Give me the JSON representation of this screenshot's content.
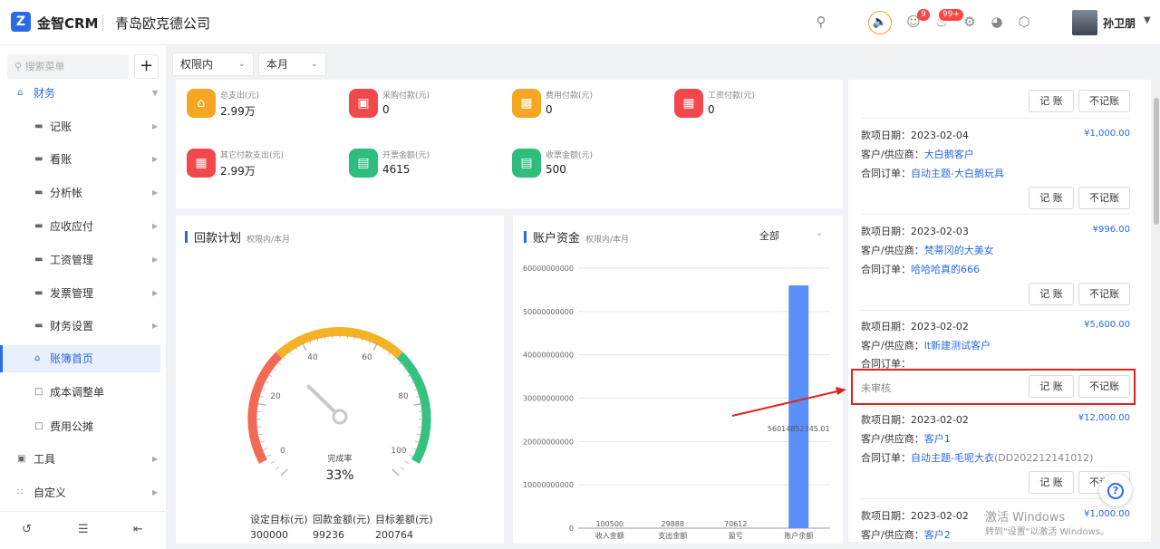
{
  "header": {
    "logo_mark": "Z",
    "logo": "金智CRM",
    "company": "青岛欧克德公司",
    "badge_tasks": "9",
    "badge_notices": "99+",
    "user": "孙卫朋"
  },
  "sidebar": {
    "search_placeholder": "搜索菜单",
    "plus": "+",
    "group": "财务",
    "items": [
      {
        "label": "记账"
      },
      {
        "label": "看账"
      },
      {
        "label": "分析帐"
      },
      {
        "label": "应收应付"
      },
      {
        "label": "工资管理"
      },
      {
        "label": "发票管理"
      },
      {
        "label": "财务设置"
      },
      {
        "label": "账簿首页"
      },
      {
        "label": "成本调整单"
      },
      {
        "label": "费用公摊"
      }
    ],
    "tools": "工具",
    "custom": "自定义"
  },
  "filters": {
    "scope": "权限内",
    "period": "本月"
  },
  "stats": [
    {
      "label": "总支出(元)",
      "value": "2.99万",
      "color": "#f5a623"
    },
    {
      "label": "采购付款(元)",
      "value": "0",
      "color": "#f2484c"
    },
    {
      "label": "费用付款(元)",
      "value": "0",
      "color": "#f5a623"
    },
    {
      "label": "工资付款(元)",
      "value": "0",
      "color": "#f2484c"
    },
    {
      "label": "其它付款支出(元)",
      "value": "2.99万",
      "color": "#f2484c"
    },
    {
      "label": "开票金额(元)",
      "value": "4615",
      "color": "#2ebd7c"
    },
    {
      "label": "收票金额(元)",
      "value": "500",
      "color": "#2ebd7c"
    }
  ],
  "gauge": {
    "title": "回款计划",
    "sub": "权限内/本月",
    "ticks": [
      "0",
      "20",
      "40",
      "60",
      "80",
      "100"
    ],
    "caption": "完成率",
    "pct_label": "33%",
    "pct": 0.33,
    "summary_headers": [
      "设定目标(元)",
      "回款金额(元)",
      "目标差额(元)"
    ],
    "summary_values": [
      "300000",
      "99236",
      "200764"
    ]
  },
  "chart_data": {
    "type": "bar",
    "title": "账户资金",
    "subtitle": "权限内/本月",
    "filter": "全部",
    "categories": [
      "收入金额",
      "支出金额",
      "盈亏",
      "账户余额"
    ],
    "values": [
      100500,
      29888,
      70612,
      56014852345.01
    ],
    "bar_labels": [
      "100500",
      "29888",
      "70612",
      "56014852345.01"
    ],
    "yticks": [
      "0",
      "10000000000",
      "20000000000",
      "30000000000",
      "40000000000",
      "50000000000",
      "60000000000"
    ],
    "ylim": [
      0,
      60000000000
    ],
    "color": "#5b8ff9",
    "grid": true
  },
  "records": [
    {
      "date": "款项日期：2023-02-04",
      "amount": "¥1,000.00",
      "customer": "大白鹅客户",
      "order": "自动主题-大白鹅玩具",
      "order_no": ""
    },
    {
      "date": "款项日期：2023-02-03",
      "amount": "¥996.00",
      "customer": "梵蒂冈的大美女",
      "order": "哈哈哈真的666",
      "order_no": ""
    },
    {
      "date": "款项日期：2023-02-02",
      "amount": "¥5,600.00",
      "customer": "lt新建测试客户",
      "order": "",
      "order_no": "",
      "status": "未审核"
    },
    {
      "date": "款项日期：2023-02-02",
      "amount": "¥12,000.00",
      "customer": "客户1",
      "order": "自动主题-毛呢大衣",
      "order_no": "(DD202212141012)"
    },
    {
      "date": "款项日期：2023-02-02",
      "amount": "¥1,000.00",
      "customer": "客户2",
      "order": "",
      "order_no": ""
    }
  ],
  "labels": {
    "cust": "客户/供应商：",
    "ord": "合同订单：",
    "book": "记 账",
    "nobook": "不记账"
  },
  "watermark": {
    "line1": "激活 Windows",
    "line2": "转到\"设置\"以激活 Windows。"
  }
}
